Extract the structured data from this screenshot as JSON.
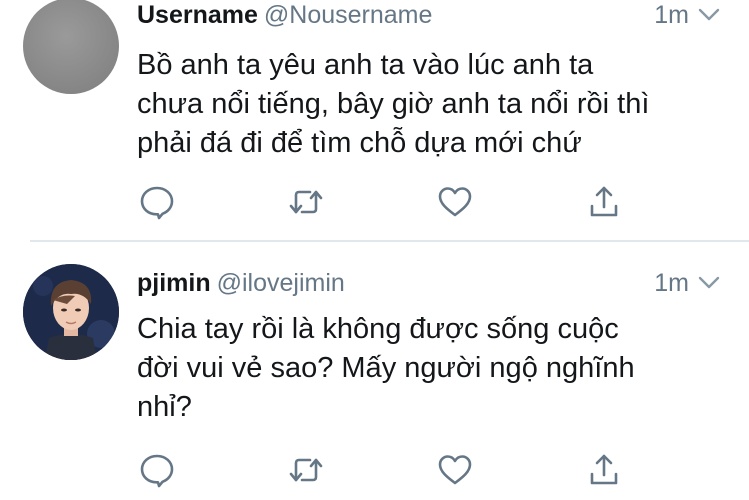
{
  "tweets": [
    {
      "display_name": "Username",
      "handle": "@Nousername",
      "time": "1m",
      "lines": [
        "Bồ anh ta yêu anh ta vào lúc anh ta",
        "chưa nổi tiếng, bây giờ anh ta nổi rồi thì",
        "phải đá đi để tìm chỗ dựa mới chứ"
      ]
    },
    {
      "display_name": "pjimin",
      "handle": "@ilovejimin",
      "time": "1m",
      "lines": [
        "Chia tay rồi là không được sống cuộc",
        "đời vui vẻ sao? Mấy người ngộ nghĩnh",
        "nhỉ?"
      ]
    }
  ],
  "icons": [
    "chevron-down-icon",
    "reply-icon",
    "retweet-icon",
    "like-icon",
    "share-icon"
  ],
  "colors": {
    "text": "#14171a",
    "secondary": "#657786",
    "icon": "#657786",
    "divider": "#e1e8ed"
  }
}
